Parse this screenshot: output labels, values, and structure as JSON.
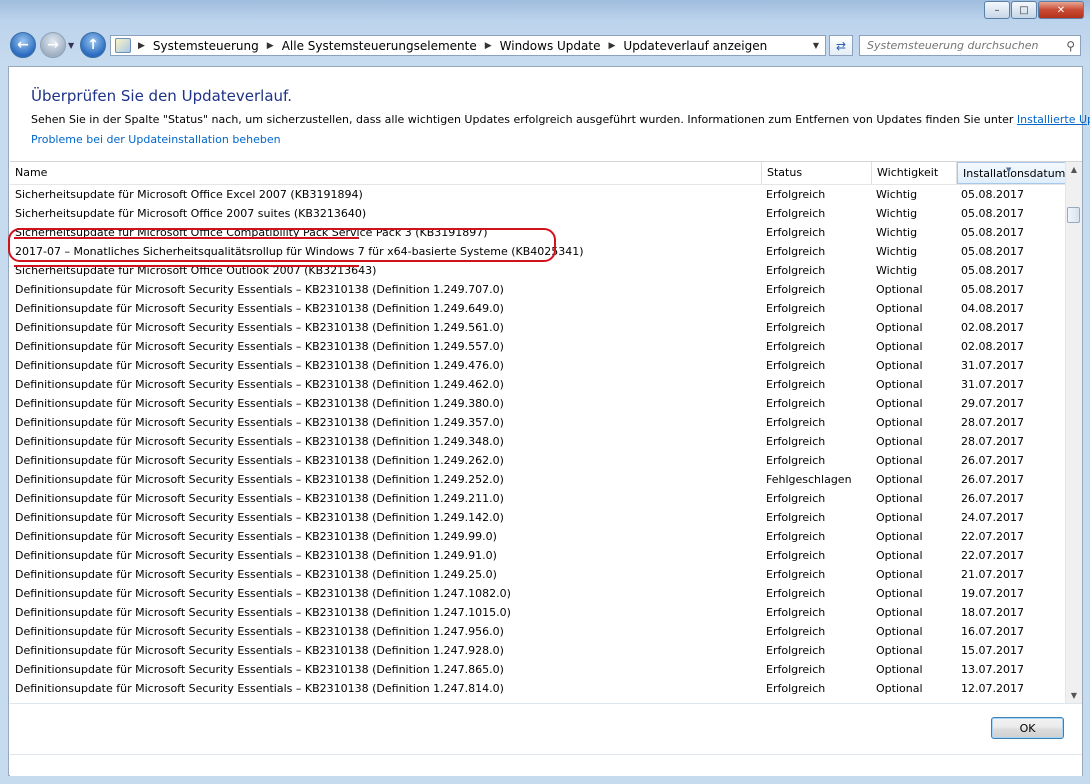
{
  "window": {
    "minimize_glyph": "–",
    "maximize_glyph": "□",
    "close_glyph": "✕"
  },
  "nav": {
    "back_icon": "arrow-left-icon",
    "forward_icon": "arrow-right-icon",
    "up_icon": "arrow-up-icon"
  },
  "address": {
    "breadcrumbs": [
      "Systemsteuerung",
      "Alle Systemsteuerungselemente",
      "Windows Update",
      "Updateverlauf anzeigen"
    ]
  },
  "search": {
    "placeholder": "Systemsteuerung durchsuchen"
  },
  "page": {
    "title": "Überprüfen Sie den Updateverlauf.",
    "description": "Sehen Sie in der Spalte \"Status\" nach, um sicherzustellen, dass alle wichtigen Updates erfolgreich ausgeführt wurden. Informationen zum Entfernen von Updates finden Sie unter ",
    "installed_updates_link": "Installierte Updates",
    "description_end": ".",
    "troubleshoot_link": "Probleme bei der Updateinstallation beheben"
  },
  "table": {
    "columns": [
      "Name",
      "Status",
      "Wichtigkeit",
      "Installationsdatum"
    ],
    "sorted_column": "Installationsdatum",
    "rows": [
      [
        "Sicherheitsupdate für Microsoft Office Excel 2007 (KB3191894)",
        "Erfolgreich",
        "Wichtig",
        "05.08.2017"
      ],
      [
        "Sicherheitsupdate für Microsoft Office 2007 suites (KB3213640)",
        "Erfolgreich",
        "Wichtig",
        "05.08.2017"
      ],
      [
        "Sicherheitsupdate für Microsoft Office Compatibility Pack Service Pack 3 (KB3191897)",
        "Erfolgreich",
        "Wichtig",
        "05.08.2017"
      ],
      [
        "2017-07 – Monatliches Sicherheitsqualitätsrollup für Windows 7 für x64-basierte Systeme (KB4025341)",
        "Erfolgreich",
        "Wichtig",
        "05.08.2017"
      ],
      [
        "Sicherheitsupdate für Microsoft Office Outlook 2007 (KB3213643)",
        "Erfolgreich",
        "Wichtig",
        "05.08.2017"
      ],
      [
        "Definitionsupdate für Microsoft Security Essentials – KB2310138 (Definition 1.249.707.0)",
        "Erfolgreich",
        "Optional",
        "05.08.2017"
      ],
      [
        "Definitionsupdate für Microsoft Security Essentials – KB2310138 (Definition 1.249.649.0)",
        "Erfolgreich",
        "Optional",
        "04.08.2017"
      ],
      [
        "Definitionsupdate für Microsoft Security Essentials – KB2310138 (Definition 1.249.561.0)",
        "Erfolgreich",
        "Optional",
        "02.08.2017"
      ],
      [
        "Definitionsupdate für Microsoft Security Essentials – KB2310138 (Definition 1.249.557.0)",
        "Erfolgreich",
        "Optional",
        "02.08.2017"
      ],
      [
        "Definitionsupdate für Microsoft Security Essentials – KB2310138 (Definition 1.249.476.0)",
        "Erfolgreich",
        "Optional",
        "31.07.2017"
      ],
      [
        "Definitionsupdate für Microsoft Security Essentials – KB2310138 (Definition 1.249.462.0)",
        "Erfolgreich",
        "Optional",
        "31.07.2017"
      ],
      [
        "Definitionsupdate für Microsoft Security Essentials – KB2310138 (Definition 1.249.380.0)",
        "Erfolgreich",
        "Optional",
        "29.07.2017"
      ],
      [
        "Definitionsupdate für Microsoft Security Essentials – KB2310138 (Definition 1.249.357.0)",
        "Erfolgreich",
        "Optional",
        "28.07.2017"
      ],
      [
        "Definitionsupdate für Microsoft Security Essentials – KB2310138 (Definition 1.249.348.0)",
        "Erfolgreich",
        "Optional",
        "28.07.2017"
      ],
      [
        "Definitionsupdate für Microsoft Security Essentials – KB2310138 (Definition 1.249.262.0)",
        "Erfolgreich",
        "Optional",
        "26.07.2017"
      ],
      [
        "Definitionsupdate für Microsoft Security Essentials – KB2310138 (Definition 1.249.252.0)",
        "Fehlgeschlagen",
        "Optional",
        "26.07.2017"
      ],
      [
        "Definitionsupdate für Microsoft Security Essentials – KB2310138 (Definition 1.249.211.0)",
        "Erfolgreich",
        "Optional",
        "26.07.2017"
      ],
      [
        "Definitionsupdate für Microsoft Security Essentials – KB2310138 (Definition 1.249.142.0)",
        "Erfolgreich",
        "Optional",
        "24.07.2017"
      ],
      [
        "Definitionsupdate für Microsoft Security Essentials – KB2310138 (Definition 1.249.99.0)",
        "Erfolgreich",
        "Optional",
        "22.07.2017"
      ],
      [
        "Definitionsupdate für Microsoft Security Essentials – KB2310138 (Definition 1.249.91.0)",
        "Erfolgreich",
        "Optional",
        "22.07.2017"
      ],
      [
        "Definitionsupdate für Microsoft Security Essentials – KB2310138 (Definition 1.249.25.0)",
        "Erfolgreich",
        "Optional",
        "21.07.2017"
      ],
      [
        "Definitionsupdate für Microsoft Security Essentials – KB2310138 (Definition 1.247.1082.0)",
        "Erfolgreich",
        "Optional",
        "19.07.2017"
      ],
      [
        "Definitionsupdate für Microsoft Security Essentials – KB2310138 (Definition 1.247.1015.0)",
        "Erfolgreich",
        "Optional",
        "18.07.2017"
      ],
      [
        "Definitionsupdate für Microsoft Security Essentials – KB2310138 (Definition 1.247.956.0)",
        "Erfolgreich",
        "Optional",
        "16.07.2017"
      ],
      [
        "Definitionsupdate für Microsoft Security Essentials – KB2310138 (Definition 1.247.928.0)",
        "Erfolgreich",
        "Optional",
        "15.07.2017"
      ],
      [
        "Definitionsupdate für Microsoft Security Essentials – KB2310138 (Definition 1.247.865.0)",
        "Erfolgreich",
        "Optional",
        "13.07.2017"
      ],
      [
        "Definitionsupdate für Microsoft Security Essentials – KB2310138 (Definition 1.247.814.0)",
        "Erfolgreich",
        "Optional",
        "12.07.2017"
      ]
    ],
    "annotation": {
      "highlight_color": "#d0121c",
      "highlighted_row": 3,
      "struck_rows": [
        2,
        4
      ]
    }
  },
  "footer": {
    "ok_label": "OK"
  }
}
